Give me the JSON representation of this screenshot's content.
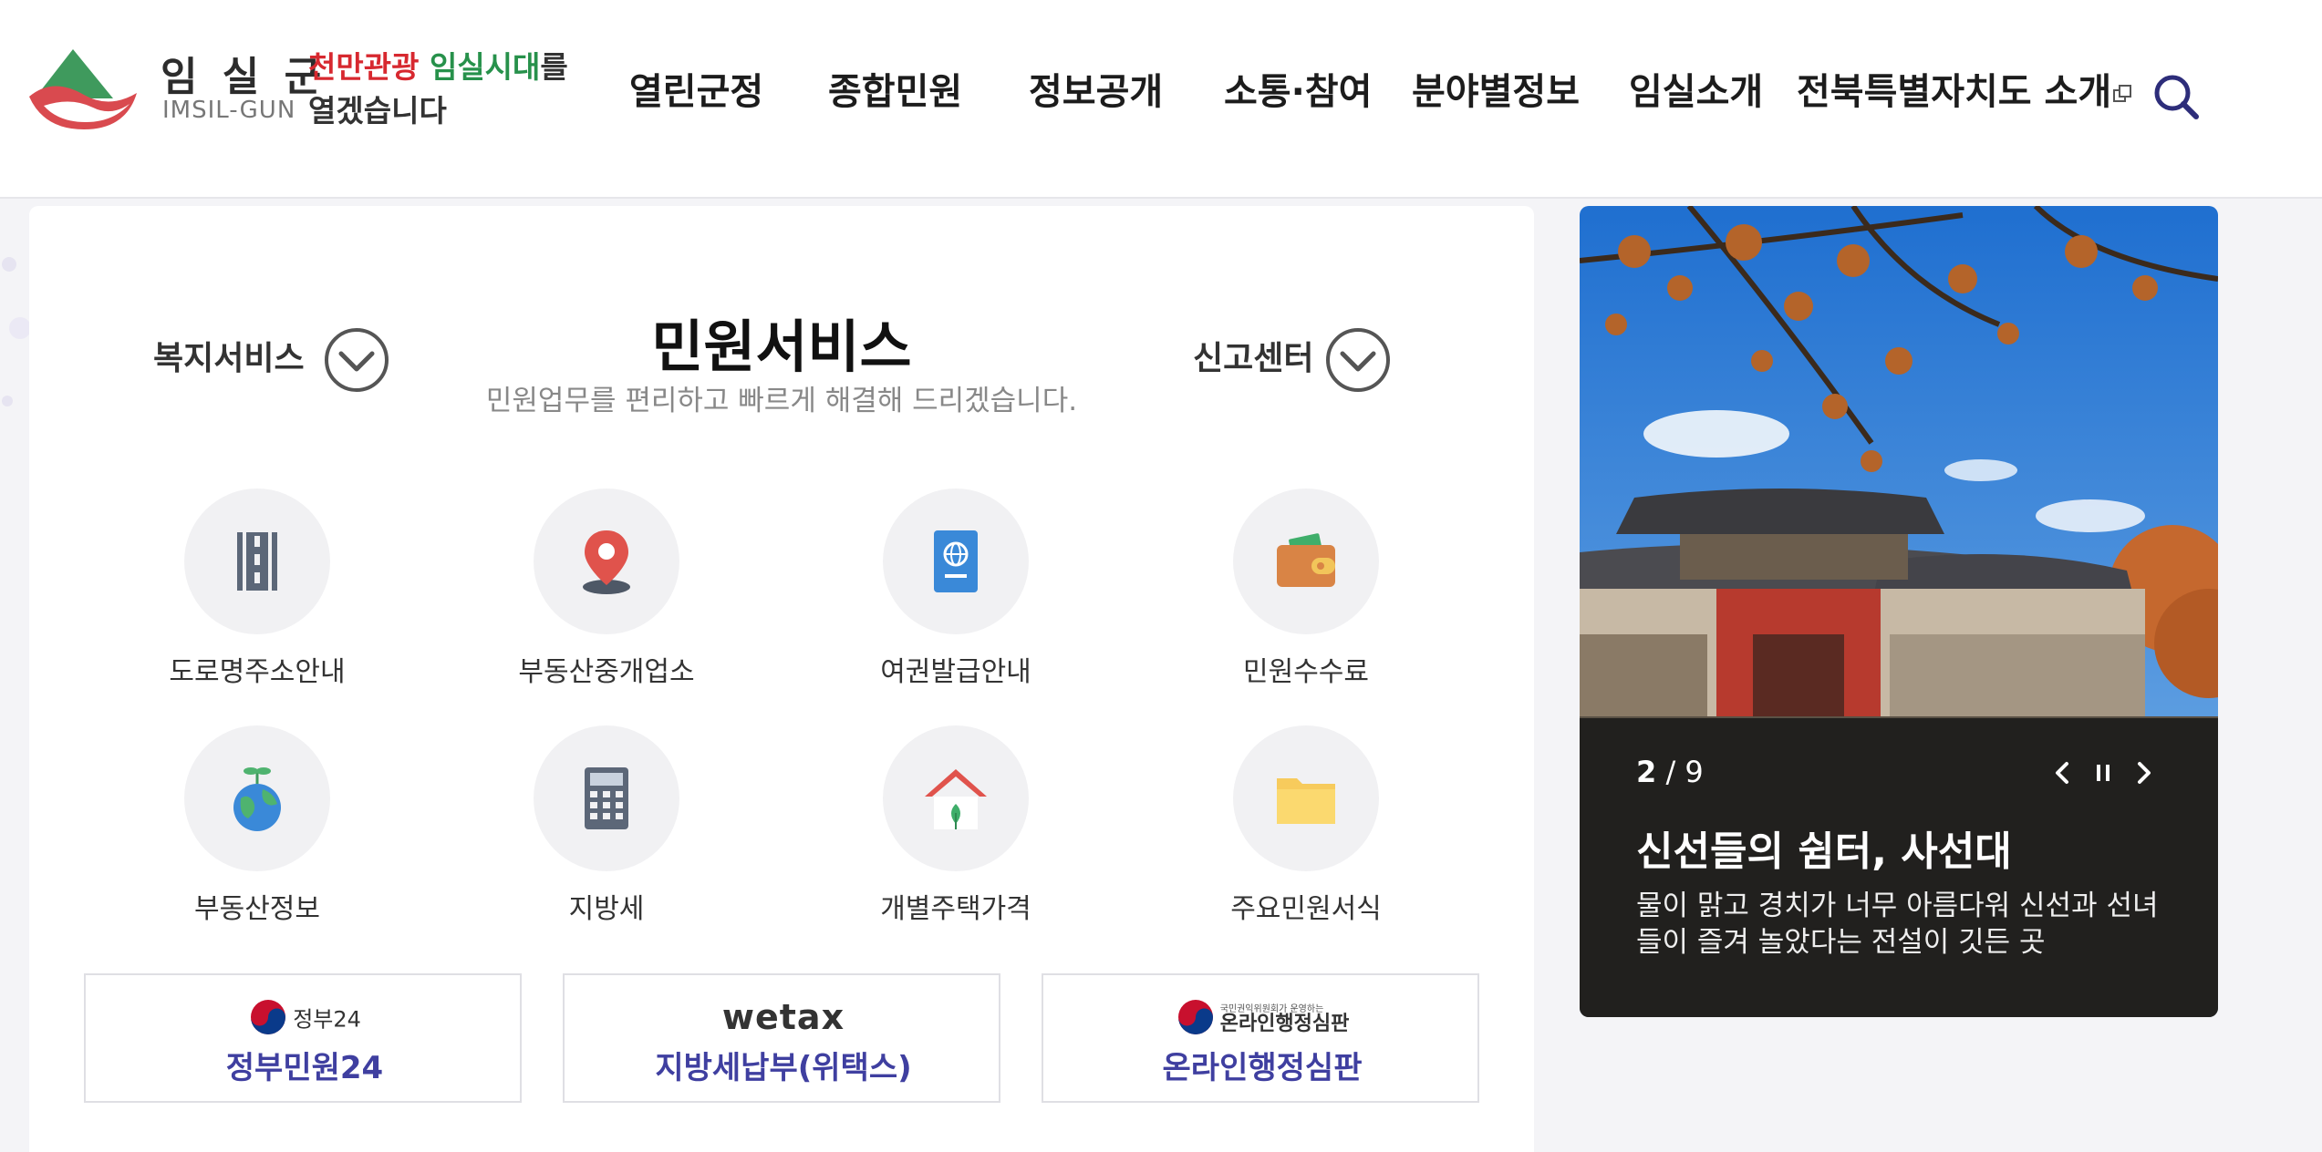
{
  "header": {
    "logo": {
      "kor": "임 실 군",
      "eng": "IMSIL-GUN"
    },
    "slogan": {
      "part1": "천만관광",
      "part2": "임실시대",
      "part3": "를",
      "line2": "열겠습니다"
    },
    "nav": [
      "열린군정",
      "종합민원",
      "정보공개",
      "소통·참여",
      "분야별정보",
      "임실소개",
      "전북특별자치도 소개"
    ]
  },
  "panel": {
    "title": "민원서비스",
    "subtitle": "민원업무를 편리하고 빠르게 해결해 드리겠습니다.",
    "left_link": "복지서비스",
    "right_link": "신고센터",
    "services": [
      {
        "label": "도로명주소안내",
        "icon": "road-icon"
      },
      {
        "label": "부동산중개업소",
        "icon": "location-pin-icon"
      },
      {
        "label": "여권발급안내",
        "icon": "passport-icon"
      },
      {
        "label": "민원수수료",
        "icon": "wallet-icon"
      },
      {
        "label": "부동산정보",
        "icon": "globe-sprout-icon"
      },
      {
        "label": "지방세",
        "icon": "calculator-icon"
      },
      {
        "label": "개별주택가격",
        "icon": "house-icon"
      },
      {
        "label": "주요민원서식",
        "icon": "folder-icon"
      }
    ],
    "links": [
      {
        "logo_text": "정부24",
        "label": "정부민원24"
      },
      {
        "logo_text": "wetax",
        "label": "지방세납부(위택스)"
      },
      {
        "logo_small": "국민권익위원회가 운영하는",
        "logo_text": "온라인행정심판",
        "label": "온라인행정심판"
      }
    ]
  },
  "slider": {
    "current": "2",
    "separator": "/",
    "total": "9",
    "title": "신선들의 쉼터, 사선대",
    "description": "물이 맑고 경치가 너무 아름다워 신선과 선녀들이 즐겨 놀았다는 전설이 깃든 곳"
  },
  "colors": {
    "accent": "#3f3fa0",
    "red": "#d7282f",
    "green": "#27914b"
  }
}
